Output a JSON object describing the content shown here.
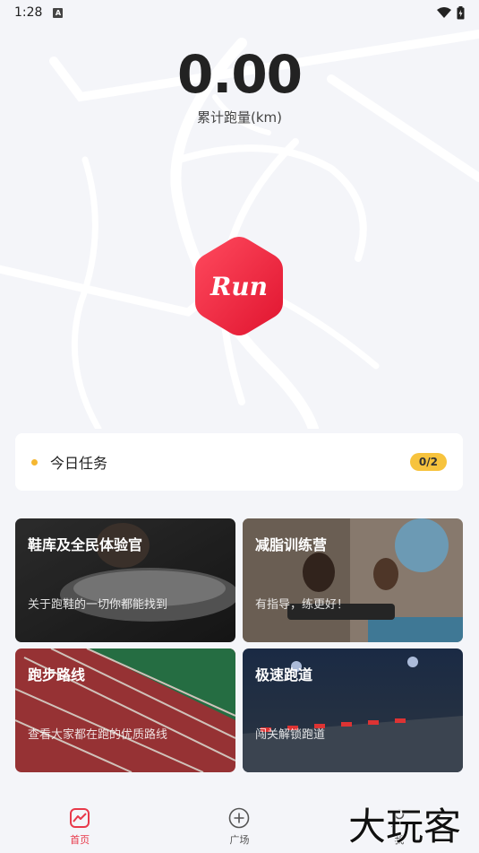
{
  "status_bar": {
    "time": "1:28",
    "notif_letter": "A"
  },
  "summary": {
    "distance_value": "0.00",
    "distance_label": "累计跑量(km)"
  },
  "logo": {
    "text": "Run",
    "color": "#e8213f"
  },
  "task": {
    "title": "今日任务",
    "progress": "0/2",
    "dot_color": "#f5b731"
  },
  "tiles": [
    {
      "title": "鞋库及全民体验官",
      "subtitle": "关于跑鞋的一切你都能找到"
    },
    {
      "title": "减脂训练营",
      "subtitle": "有指导，练更好！"
    },
    {
      "title": "跑步路线",
      "subtitle": "查看大家都在跑的优质路线"
    },
    {
      "title": "极速跑道",
      "subtitle": "闯关解锁跑道"
    }
  ],
  "tabs": [
    {
      "label": "首页",
      "icon": "home-chart-icon",
      "active": true
    },
    {
      "label": "广场",
      "icon": "plus-circle-icon",
      "active": false
    },
    {
      "label": "我",
      "icon": "user-icon",
      "active": false
    }
  ],
  "watermark": {
    "text": "大玩客"
  },
  "colors": {
    "accent": "#e8394a",
    "background": "#f4f5f9",
    "badge": "#f7c33d"
  }
}
